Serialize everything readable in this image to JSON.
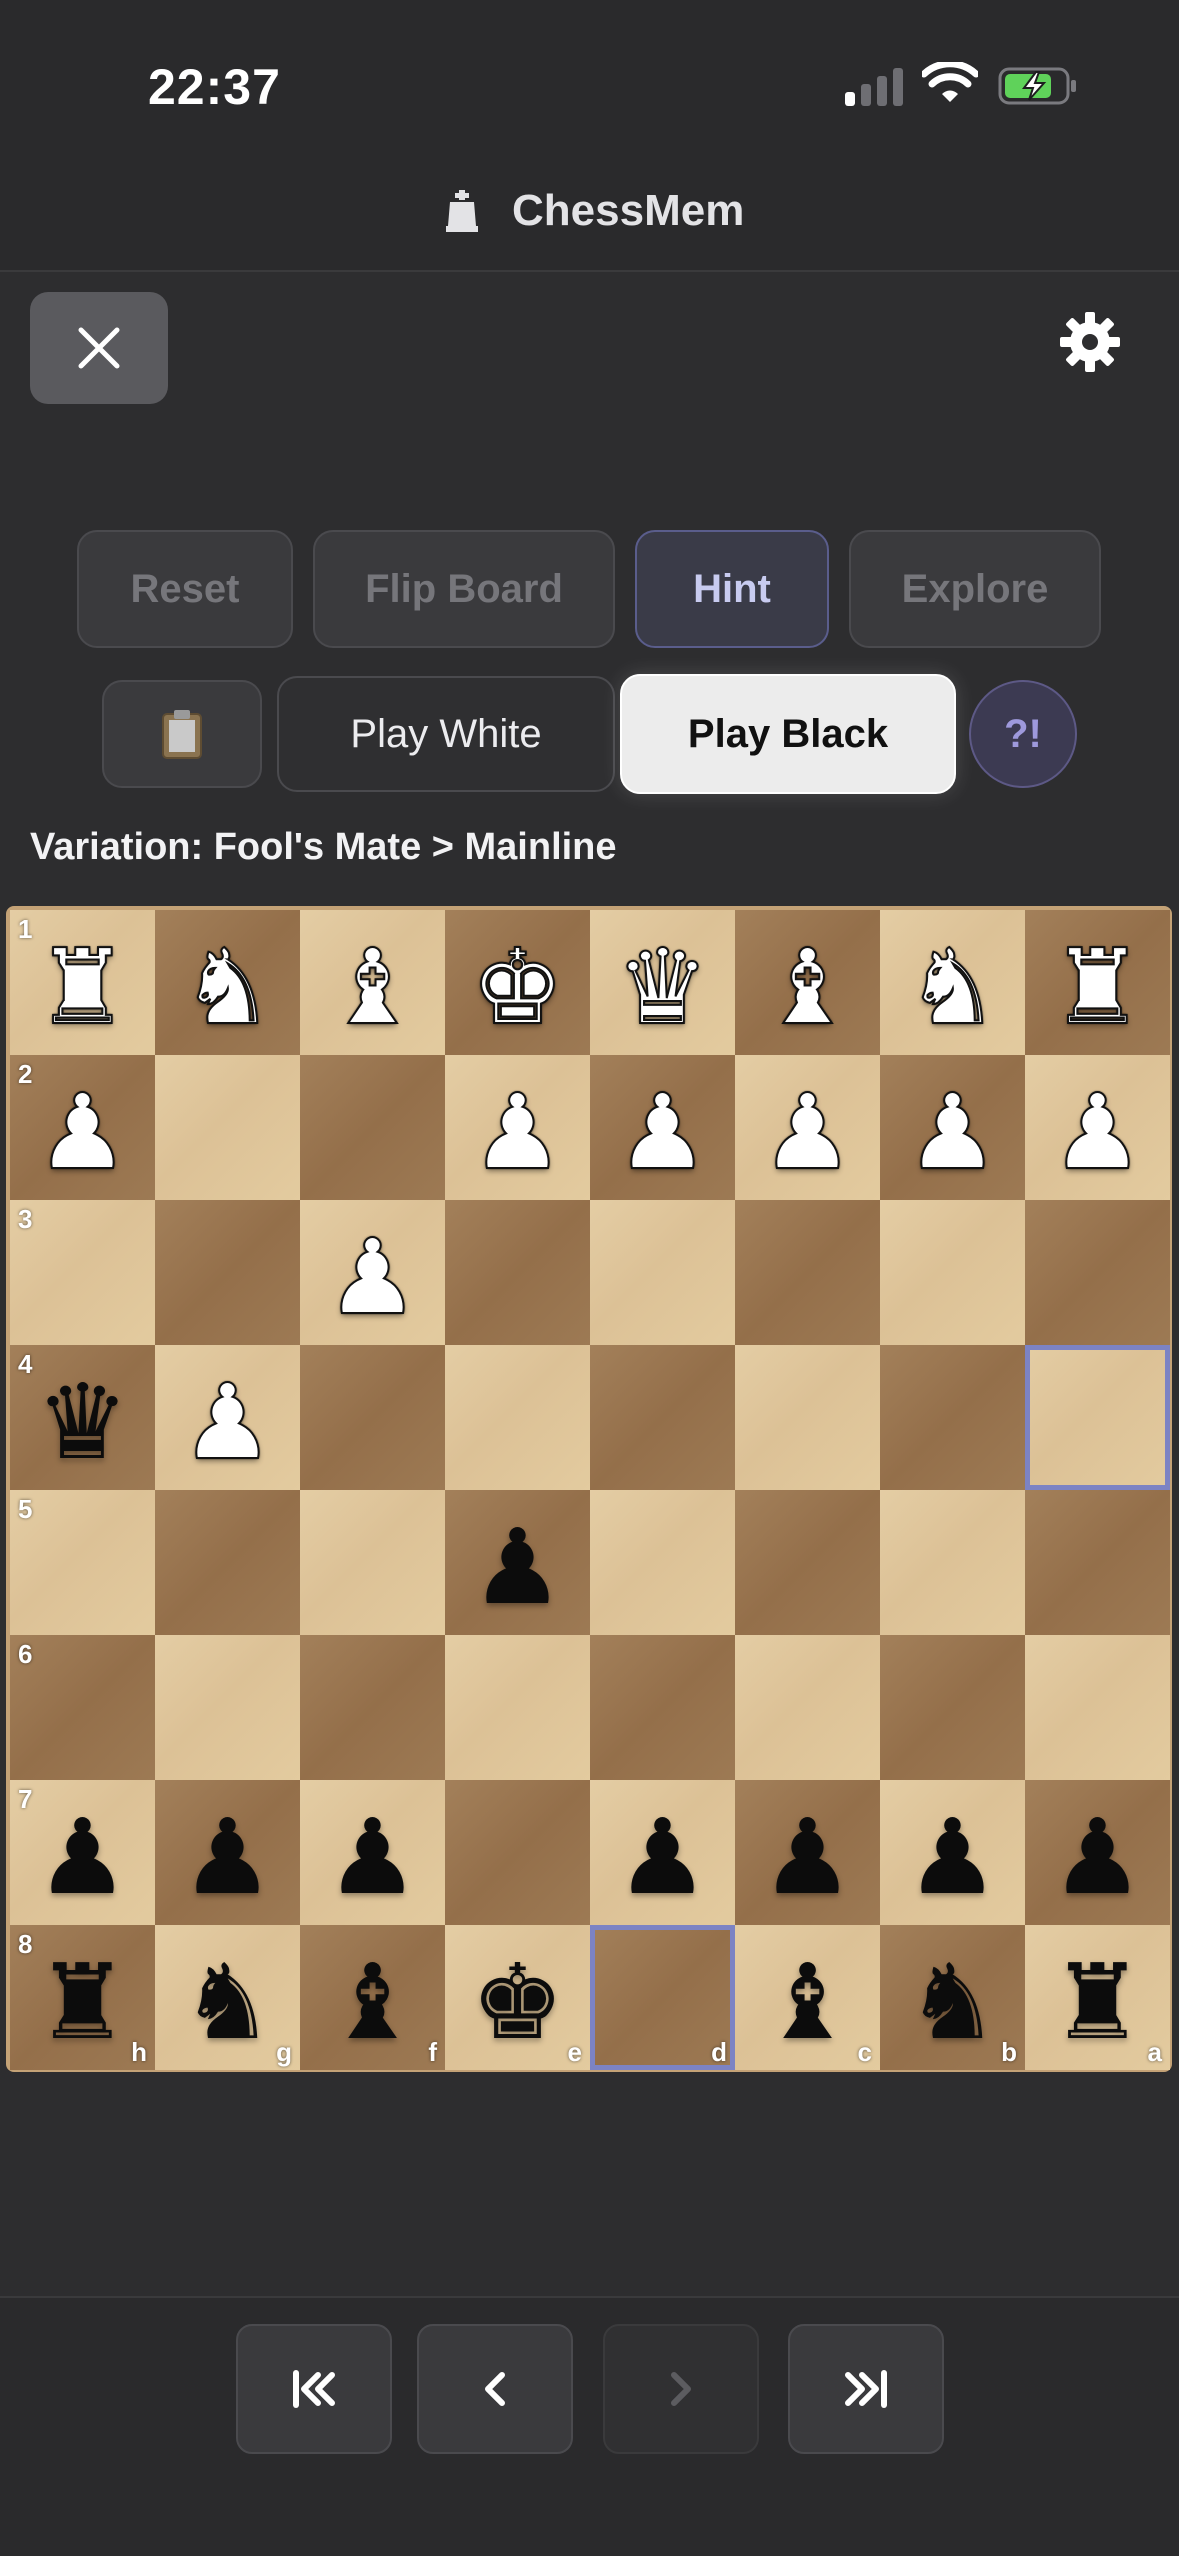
{
  "status_bar": {
    "time": "22:37"
  },
  "header": {
    "title": "ChessMem"
  },
  "toolbar": {
    "reset_label": "Reset",
    "flip_label": "Flip Board",
    "hint_label": "Hint",
    "explore_label": "Explore",
    "play_white_label": "Play White",
    "play_black_label": "Play Black",
    "annotation_label": "?!"
  },
  "variation": {
    "text": "Variation: Fool's Mate > Mainline"
  },
  "board": {
    "orientation": "black",
    "highlight_squares": [
      "a4",
      "d8"
    ],
    "rows": [
      {
        "rank": "1",
        "pieces": [
          "wR",
          "wN",
          "wB",
          "wK",
          "wQ",
          "wB",
          "wN",
          "wR"
        ]
      },
      {
        "rank": "2",
        "pieces": [
          "wP",
          "",
          "",
          "wP",
          "wP",
          "wP",
          "wP",
          "wP"
        ]
      },
      {
        "rank": "3",
        "pieces": [
          "",
          "",
          "wP",
          "",
          "",
          "",
          "",
          ""
        ]
      },
      {
        "rank": "4",
        "pieces": [
          "bQ",
          "wP",
          "",
          "",
          "",
          "",
          "",
          ""
        ]
      },
      {
        "rank": "5",
        "pieces": [
          "",
          "",
          "",
          "bP",
          "",
          "",
          "",
          ""
        ]
      },
      {
        "rank": "6",
        "pieces": [
          "",
          "",
          "",
          "",
          "",
          "",
          "",
          ""
        ]
      },
      {
        "rank": "7",
        "pieces": [
          "bP",
          "bP",
          "bP",
          "",
          "bP",
          "bP",
          "bP",
          "bP"
        ]
      },
      {
        "rank": "8",
        "pieces": [
          "bR",
          "bN",
          "bB",
          "bK",
          "",
          "bB",
          "bN",
          "bR"
        ]
      }
    ],
    "files": [
      "h",
      "g",
      "f",
      "e",
      "d",
      "c",
      "b",
      "a"
    ]
  },
  "nav": {
    "first_icon": "skip-to-start-icon",
    "prev_icon": "chevron-left-icon",
    "next_icon": "chevron-right-icon",
    "last_icon": "skip-to-end-icon",
    "next_disabled": true
  },
  "colors": {
    "accent": "#7c83c4",
    "light_square": "#e0c89c",
    "dark_square": "#9a7650"
  }
}
